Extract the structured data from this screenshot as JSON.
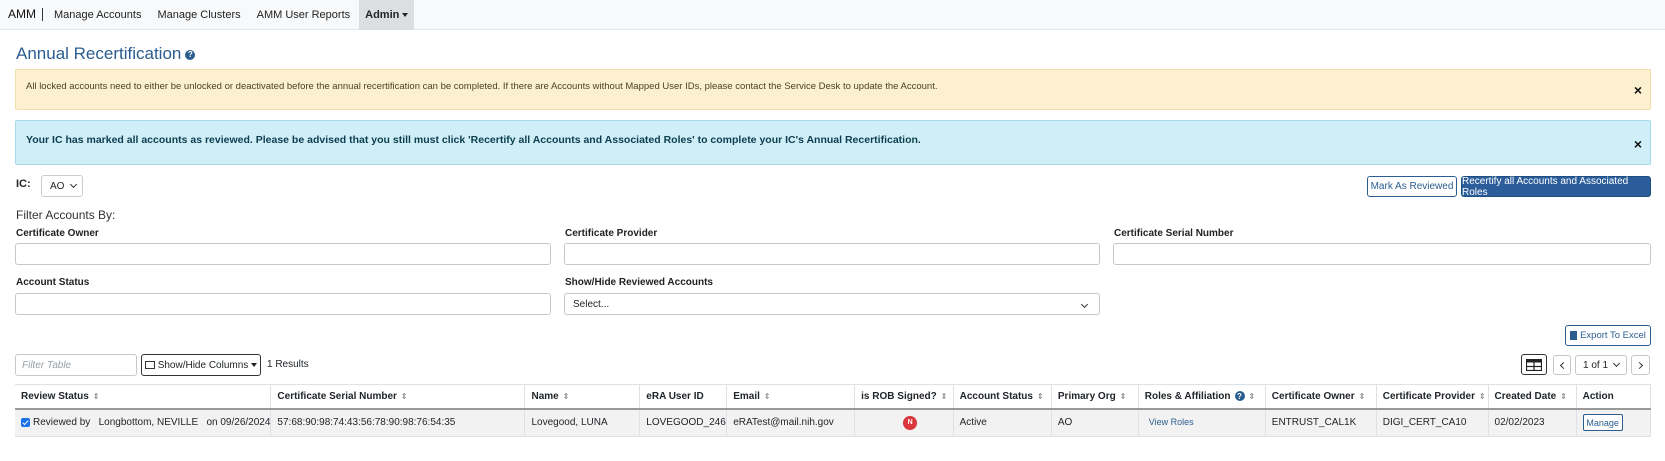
{
  "nav": {
    "brand": "AMM",
    "links": [
      "Manage Accounts",
      "Manage Clusters",
      "AMM User Reports"
    ],
    "admin": "Admin"
  },
  "page": {
    "title": "Annual Recertification"
  },
  "alerts": {
    "warning": "All locked accounts need to either be unlocked or deactivated before the annual recertification can be completed. If there are Accounts without Mapped User IDs, please contact the Service Desk to update the Account.",
    "info": "Your IC has marked all accounts as reviewed. Please be advised that you still must click 'Recertify all Accounts and Associated Roles' to complete your IC's Annual Recertification.",
    "close": "×"
  },
  "ic": {
    "label": "IC:",
    "value": "AO"
  },
  "actions": {
    "mark_reviewed": "Mark As Reviewed",
    "recertify": "Recertify all Accounts and Associated Roles"
  },
  "filters": {
    "heading": "Filter Accounts By:",
    "certificate_owner": "Certificate Owner",
    "certificate_provider": "Certificate Provider",
    "certificate_serial": "Certificate Serial Number",
    "account_status": "Account Status",
    "show_hide_reviewed": "Show/Hide Reviewed Accounts",
    "show_hide_placeholder": "Select..."
  },
  "toolbar": {
    "export": "Export To Excel",
    "filter_placeholder": "Filter Table",
    "show_hide_columns": "Show/Hide Columns",
    "results": "1 Results",
    "page_select": "1 of 1"
  },
  "table": {
    "columns": [
      "Review Status",
      "Certificate Serial Number",
      "Name",
      "eRA User ID",
      "Email",
      "is ROB Signed?",
      "Account Status",
      "Primary Org",
      "Roles & Affiliation",
      "Certificate Owner",
      "Certificate Provider",
      "Created Date",
      "Action"
    ],
    "rows": [
      {
        "review_status": "Reviewed by",
        "reviewer": "Longbottom, NEVILLE",
        "review_date": "on 09/26/2024",
        "serial": "57:68:90:98:74:43:56:78:90:98:76:54:35",
        "name": "Lovegood, LUNA",
        "user_id": "LOVEGOOD_246",
        "email": "eRATest@mail.nih.gov",
        "rob": "N",
        "status": "Active",
        "org": "AO",
        "roles_link": "View Roles",
        "owner": "ENTRUST_CAL1K",
        "provider": "DIGI_CERT_CA10",
        "created": "02/02/2023",
        "action": "Manage"
      }
    ]
  }
}
